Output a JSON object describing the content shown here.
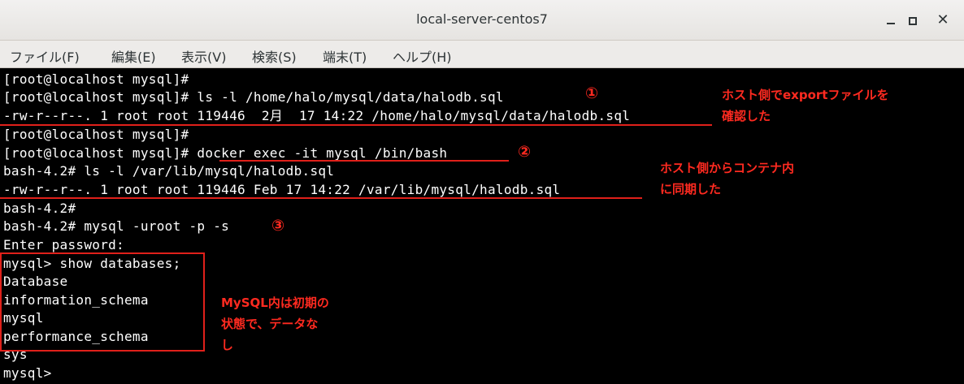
{
  "window": {
    "title": "local-server-centos7",
    "min_icon": "minimize-icon",
    "max_icon": "maximize-icon",
    "close_glyph": "✕"
  },
  "menu": [
    {
      "label": "ファイル(F)"
    },
    {
      "label": "編集(E)"
    },
    {
      "label": "表示(V)"
    },
    {
      "label": "検索(S)"
    },
    {
      "label": "端末(T)"
    },
    {
      "label": "ヘルプ(H)"
    }
  ],
  "terminal": {
    "lines": [
      "[root@localhost mysql]#",
      "[root@localhost mysql]# ls -l /home/halo/mysql/data/halodb.sql",
      "-rw-r--r--. 1 root root 119446  2月  17 14:22 /home/halo/mysql/data/halodb.sql",
      "[root@localhost mysql]#",
      "[root@localhost mysql]# docker exec -it mysql /bin/bash",
      "bash-4.2# ls -l /var/lib/mysql/halodb.sql",
      "-rw-r--r--. 1 root root 119446 Feb 17 14:22 /var/lib/mysql/halodb.sql",
      "bash-4.2#",
      "bash-4.2# mysql -uroot -p -s",
      "Enter password:",
      "mysql> show databases;",
      "Database",
      "information_schema",
      "mysql",
      "performance_schema",
      "sys",
      "mysql>"
    ]
  },
  "annotations": {
    "marker1": "①",
    "marker2": "②",
    "marker3": "③",
    "note1_line1": "ホスト側でexportファイルを",
    "note1_line2": "確認した",
    "note2_line1": "ホスト側からコンテナ内",
    "note2_line2": "に同期した",
    "note3_line1": "MySQL内は初期の",
    "note3_line2": "状態で、データな",
    "note3_line3": "し",
    "accent_color": "#e0201a"
  }
}
